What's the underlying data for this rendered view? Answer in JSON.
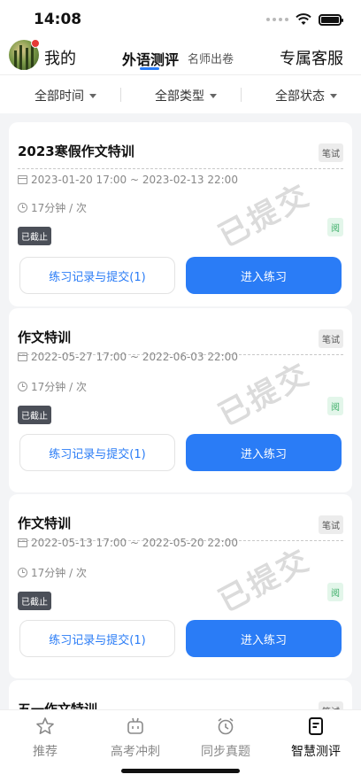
{
  "status_bar": {
    "time": "14:08"
  },
  "header": {
    "my_label": "我的",
    "tab_main": "外语测评",
    "tab_sub": "名师出卷",
    "service_label": "专属客服"
  },
  "filters": [
    {
      "label": "全部时间"
    },
    {
      "label": "全部类型"
    },
    {
      "label": "全部状态"
    }
  ],
  "cards": [
    {
      "title": "2023寒假作文特训",
      "type_badge": "笔试",
      "time_range": "2023-01-20 17:00 ~ 2023-02-13 22:00",
      "duration": "17分钟 / 次",
      "status_badge": "已截止",
      "read_badge": "阅",
      "stamp": "已提交",
      "record_button": "练习记录与提交(1)",
      "enter_button": "进入练习"
    },
    {
      "title": "作文特训",
      "type_badge": "笔试",
      "time_range": "2022-05-27 17:00 ~ 2022-06-03 22:00",
      "duration": "17分钟 / 次",
      "status_badge": "已截止",
      "read_badge": "阅",
      "stamp": "已提交",
      "record_button": "练习记录与提交(1)",
      "enter_button": "进入练习"
    },
    {
      "title": "作文特训",
      "type_badge": "笔试",
      "time_range": "2022-05-13 17:00 ~ 2022-05-20 22:00",
      "duration": "17分钟 / 次",
      "status_badge": "已截止",
      "read_badge": "阅",
      "stamp": "已提交",
      "record_button": "练习记录与提交(1)",
      "enter_button": "进入练习"
    },
    {
      "title": "五一作文特训",
      "type_badge": "笔试"
    }
  ],
  "tab_bar": [
    {
      "label": "推荐",
      "icon": "star-icon"
    },
    {
      "label": "高考冲刺",
      "icon": "robot-icon"
    },
    {
      "label": "同步真题",
      "icon": "alarm-clock-icon"
    },
    {
      "label": "智慧测评",
      "icon": "document-icon"
    }
  ],
  "colors": {
    "accent": "#2a7cf6",
    "closed_badge": "#4b4f58",
    "read_badge": "#3fb06a"
  }
}
